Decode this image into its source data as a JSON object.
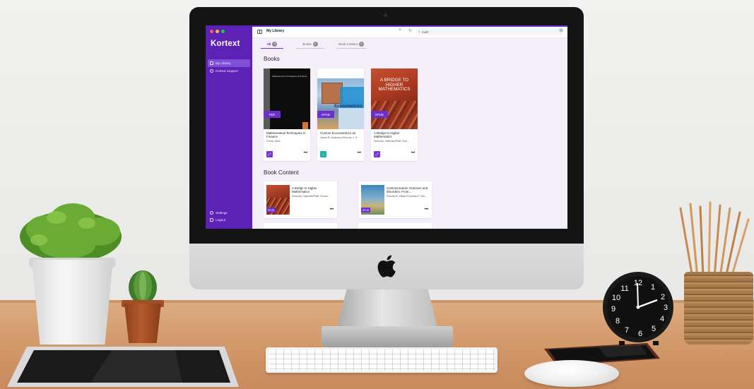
{
  "app": {
    "brand": "Kortext",
    "page_title": "My Library",
    "accent_color": "#6c2fd0",
    "sidebar_color": "#5b22b5"
  },
  "window_controls": {
    "colors": [
      "#ff5f57",
      "#febc2e",
      "#28c840"
    ]
  },
  "sidebar": {
    "nav_items": [
      {
        "label": "My Library",
        "icon": "book-icon",
        "active": true
      },
      {
        "label": "Kortext Support",
        "icon": "help-icon",
        "active": false
      }
    ],
    "bottom_items": [
      {
        "label": "Settings",
        "icon": "gear-icon"
      },
      {
        "label": "Logout",
        "icon": "logout-icon"
      }
    ]
  },
  "toolbar": {
    "search_value": "math",
    "add_icon": "plus-icon",
    "refresh_icon": "refresh-icon",
    "settings_icon": "gear-icon"
  },
  "tabs": [
    {
      "label": "All",
      "count": "4",
      "active": true
    },
    {
      "label": "Books",
      "count": "3",
      "active": false
    },
    {
      "label": "Book Content",
      "count": "4",
      "active": false
    }
  ],
  "sections": {
    "books": "Books",
    "book_content": "Book Content"
  },
  "books": [
    {
      "title": "Mathematical Techniques in Finance",
      "author": "Cerný, Ales",
      "format": "PDF",
      "cover_title": "Mathematical Techniques in Finance",
      "action_icon": "read-icon",
      "action_color": "#7a35d8"
    },
    {
      "title": "Custom Econometrics 2e",
      "author": "David R. Anderson/Dennis J. S...",
      "format": "EPUB",
      "cover_title": "Econometrics",
      "action_icon": "download-icon",
      "action_color": "#22b3a5"
    },
    {
      "title": "A Bridge to Higher Mathematics",
      "author": "Stecuriu, Valentin/Pfaff, Don...",
      "format": "EPUB",
      "cover_title": "A BRIDGE TO HIGHER MATHEMATICS",
      "action_icon": "read-icon",
      "action_color": "#7a35d8"
    }
  ],
  "book_content": [
    {
      "title": "A Bridge to Higher Mathematics",
      "author": "Stecuriu, Valentin/Pfaff, Donal...",
      "format": "EPUB"
    },
    {
      "title": "Communication Sciences and Disorders: From...",
      "author": "Ronald B. Gillam/Thomas P. Ma...",
      "format": "EPUB"
    }
  ]
}
